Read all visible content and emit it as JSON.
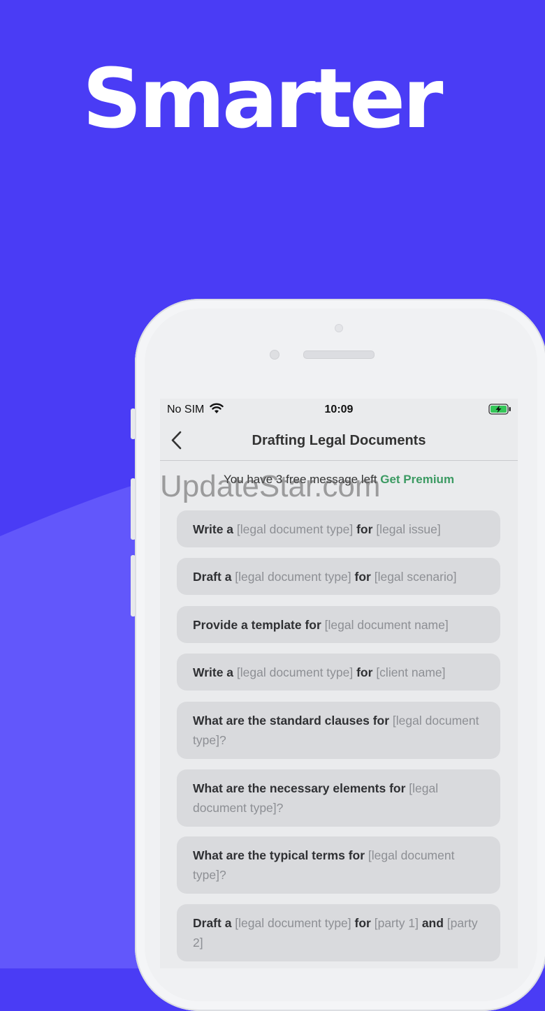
{
  "headline": "Smarter",
  "status_bar": {
    "carrier": "No SIM",
    "time": "10:09"
  },
  "nav": {
    "title": "Drafting Legal Documents"
  },
  "free_notice": {
    "text": "You have 3 free message left",
    "cta": "Get Premium"
  },
  "prompts": [
    {
      "parts": [
        {
          "b": true,
          "t": "Write a "
        },
        {
          "b": false,
          "t": "[legal document type] "
        },
        {
          "b": true,
          "t": "for "
        },
        {
          "b": false,
          "t": "[legal issue]"
        }
      ]
    },
    {
      "parts": [
        {
          "b": true,
          "t": "Draft a "
        },
        {
          "b": false,
          "t": "[legal document type] "
        },
        {
          "b": true,
          "t": "for "
        },
        {
          "b": false,
          "t": "[legal scenario]"
        }
      ]
    },
    {
      "parts": [
        {
          "b": true,
          "t": "Provide a template for "
        },
        {
          "b": false,
          "t": "[legal document name]"
        }
      ]
    },
    {
      "parts": [
        {
          "b": true,
          "t": "Write a "
        },
        {
          "b": false,
          "t": "[legal document type] "
        },
        {
          "b": true,
          "t": "for "
        },
        {
          "b": false,
          "t": "[client name]"
        }
      ]
    },
    {
      "parts": [
        {
          "b": true,
          "t": "What are the standard clauses for "
        },
        {
          "b": false,
          "t": "[legal document type]?"
        }
      ]
    },
    {
      "parts": [
        {
          "b": true,
          "t": "What are the necessary elements for "
        },
        {
          "b": false,
          "t": "[legal document type]?"
        }
      ]
    },
    {
      "parts": [
        {
          "b": true,
          "t": "What are the typical terms for "
        },
        {
          "b": false,
          "t": "[legal document type]?"
        }
      ]
    },
    {
      "parts": [
        {
          "b": true,
          "t": "Draft a "
        },
        {
          "b": false,
          "t": "[legal document type] "
        },
        {
          "b": true,
          "t": "for "
        },
        {
          "b": false,
          "t": "[party 1] "
        },
        {
          "b": true,
          "t": "and "
        },
        {
          "b": false,
          "t": "[party 2]"
        }
      ]
    }
  ],
  "watermark": "UpdateStar.com",
  "colors": {
    "background": "#4a3cf5",
    "wave": "#6257fb",
    "accent": "#3b9a62"
  }
}
